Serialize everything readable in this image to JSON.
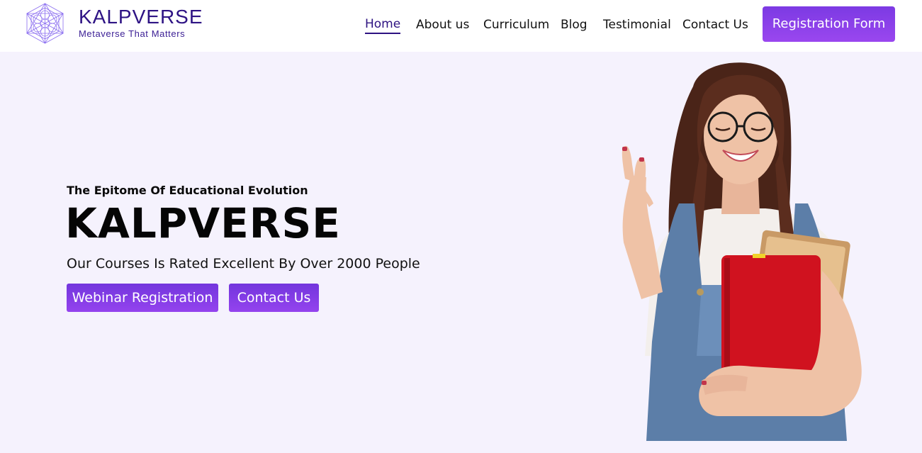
{
  "brand": {
    "name": "KALPVERSE",
    "tagline": "Metaverse That Matters",
    "logo_icon": "sacred-geometry-logo-icon"
  },
  "nav": {
    "items": [
      "Home",
      "About us",
      "Curriculum",
      "Blog",
      "Testimonial",
      "Contact Us"
    ],
    "active": "Home",
    "cta_label": "Registration Form"
  },
  "hero": {
    "eyebrow": "The Epitome Of Educational Evolution",
    "title": "KALPVERSE",
    "subtitle": "Our Courses Is Rated Excellent By Over 2000 People",
    "buttons": [
      "Webinar Registration",
      "Contact Us"
    ],
    "image_subject": "smiling-student-holding-books-image"
  },
  "colors": {
    "brand_dark": "#2e1384",
    "accent_gradient_start": "#7c3ae3",
    "accent_gradient_end": "#9a47ef",
    "hero_background": "#f5f2fd",
    "header_background": "#ffffff"
  }
}
